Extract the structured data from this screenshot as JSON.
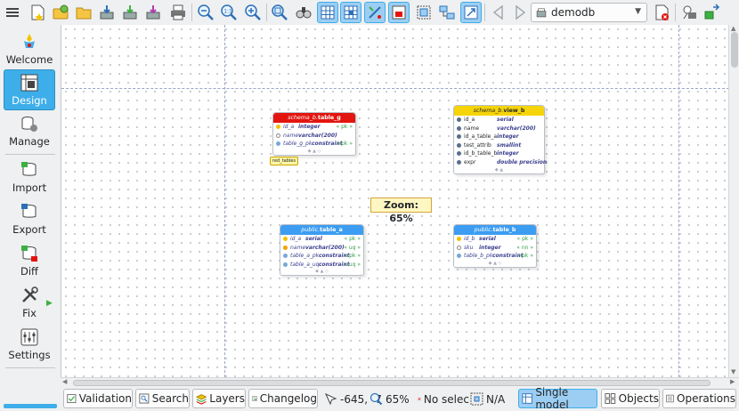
{
  "toolbar": {
    "buttons": [
      "menu",
      "new-model",
      "new-from-db",
      "open",
      "save",
      "save-as",
      "save-all",
      "print",
      "zoom-out",
      "zoom-normal",
      "zoom-in",
      "adjust-zoom",
      "find",
      "show-grid",
      "align-to-grid",
      "show-delimiters",
      "overlay",
      "select-objects",
      "arrange",
      "fullscreen",
      "back",
      "forward",
      "close",
      "database",
      "diff"
    ],
    "database_combo": "demodb"
  },
  "sidebar": {
    "items": [
      {
        "label": "Welcome",
        "icon": "welcome-icon"
      },
      {
        "label": "Design",
        "icon": "design-icon",
        "active": true
      },
      {
        "label": "Manage",
        "icon": "manage-icon"
      },
      {
        "label": "Import",
        "icon": "import-icon"
      },
      {
        "label": "Export",
        "icon": "export-icon"
      },
      {
        "label": "Diff",
        "icon": "diff-icon"
      },
      {
        "label": "Fix",
        "icon": "fix-icon"
      },
      {
        "label": "Settings",
        "icon": "settings-icon"
      }
    ]
  },
  "canvas": {
    "zoom_label": "Zoom: 65%",
    "tag_label": "red_tables",
    "tables": [
      {
        "id": "table_g",
        "schema": "schema_b.",
        "name": "table_g",
        "color": "red",
        "rows": [
          {
            "name": "id_a",
            "type": "integer",
            "key": "« pk »",
            "kind": "pk"
          },
          {
            "name": "name",
            "type": "varchar(200)",
            "key": "",
            "kind": "col"
          },
          {
            "name": "table_g_pk",
            "type": "constraint",
            "key": "« pk »",
            "kind": "constraint"
          }
        ]
      },
      {
        "id": "view_b",
        "schema": "schema_b.",
        "name": "view_b",
        "color": "yellow",
        "rows": [
          {
            "name": "id_a",
            "type": "serial"
          },
          {
            "name": "name",
            "type": "varchar(200)"
          },
          {
            "name": "id_a_table_a",
            "type": "integer"
          },
          {
            "name": "test_attrib",
            "type": "smallint"
          },
          {
            "name": "id_b_table_b",
            "type": "integer"
          },
          {
            "name": "expr",
            "type": "double precision"
          }
        ]
      },
      {
        "id": "table_a",
        "schema": "public.",
        "name": "table_a",
        "color": "blue",
        "rows": [
          {
            "name": "id_a",
            "type": "serial",
            "key": "« pk »",
            "kind": "pk"
          },
          {
            "name": "name",
            "type": "varchar(200)",
            "key": "« uq »",
            "kind": "uq"
          },
          {
            "name": "table_a_pk",
            "type": "constraint",
            "key": "« pk »",
            "kind": "constraint"
          },
          {
            "name": "table_a_uq",
            "type": "constraint",
            "key": "« uq »",
            "kind": "constraint"
          }
        ]
      },
      {
        "id": "table_b",
        "schema": "public.",
        "name": "table_b",
        "color": "blue",
        "rows": [
          {
            "name": "id_b",
            "type": "serial",
            "key": "« pk »",
            "kind": "pk"
          },
          {
            "name": "sku",
            "type": "integer",
            "key": "« nn »",
            "kind": "col"
          },
          {
            "name": "table_b_pk",
            "type": "constraint",
            "key": "« pk »",
            "kind": "constraint"
          }
        ]
      }
    ]
  },
  "statusbar": {
    "validation": "Validation",
    "search": "Search",
    "layers": "Layers",
    "changelog": "Changelog",
    "position": "-645, -7",
    "zoom": "65%",
    "selection": "No selec",
    "selection_size": "N/A",
    "single_model": "Single model",
    "objects": "Objects",
    "operations": "Operations"
  },
  "colors": {
    "accent": "#3daee9",
    "table_red": "#e3150f",
    "table_blue": "#3c9df2",
    "view_yellow": "#f5d40a"
  }
}
